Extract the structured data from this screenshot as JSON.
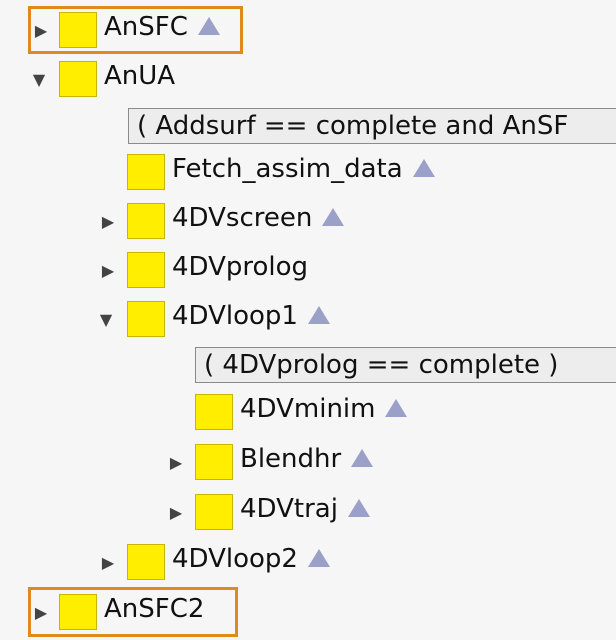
{
  "tree": {
    "anSFC": {
      "label": "AnSFC"
    },
    "anUA": {
      "label": "AnUA"
    },
    "trigger_anua": {
      "text": "( Addsurf == complete and AnSF"
    },
    "fetch": {
      "label": "Fetch_assim_data"
    },
    "screen": {
      "label": "4DVscreen"
    },
    "prolog": {
      "label": "4DVprolog"
    },
    "loop1": {
      "label": "4DVloop1"
    },
    "trigger_loop1": {
      "text": "( 4DVprolog == complete )"
    },
    "minim": {
      "label": "4DVminim"
    },
    "blend": {
      "label": "Blendhr"
    },
    "traj": {
      "label": "4DVtraj"
    },
    "loop2": {
      "label": "4DVloop2"
    },
    "anSFC2": {
      "label": "AnSFC2"
    }
  },
  "icons": {
    "expanded": "triangle-down-icon",
    "collapsed": "triangle-right-icon",
    "status": "status-triangle-icon",
    "node": "yellow-square-icon"
  },
  "colors": {
    "node_fill": "#ffee00",
    "status_icon": "#9aa0c8",
    "highlight": "#e08a1e"
  }
}
